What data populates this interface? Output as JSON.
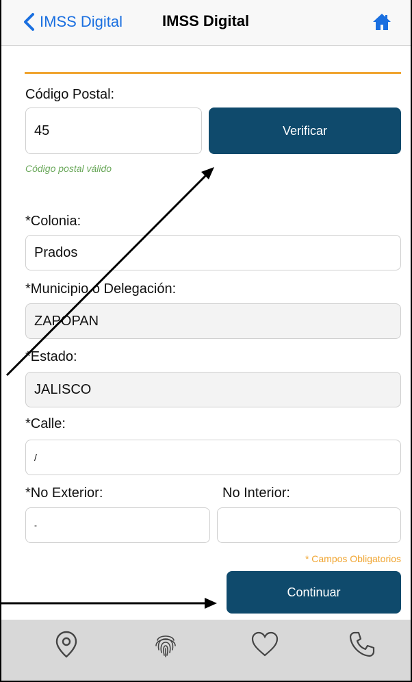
{
  "nav": {
    "back_label": "IMSS Digital",
    "title": "IMSS Digital"
  },
  "form": {
    "postal_label": "Código Postal:",
    "postal_value": "45",
    "verify_button": "Verificar",
    "postal_valid_msg": "Código postal válido",
    "colonia_label": "*Colonia:",
    "colonia_value": "Prados",
    "municipio_label": "*Municipio o Delegación:",
    "municipio_value": "ZAPOPAN",
    "estado_label": "*Estado:",
    "estado_value": "JALISCO",
    "calle_label": "*Calle:",
    "calle_value": "/",
    "no_exterior_label": "*No Exterior:",
    "no_exterior_value": "-",
    "no_interior_label": "No Interior:",
    "no_interior_value": "",
    "required_note": "* Campos Obligatorios",
    "continue_button": "Continuar"
  },
  "tabbar": {
    "icons": [
      "location-pin-icon",
      "fingerprint-icon",
      "heart-icon",
      "phone-icon"
    ]
  },
  "colors": {
    "accent_blue": "#1a6fe0",
    "button_navy": "#0f4a6c",
    "orange": "#f0a531",
    "valid_green": "#6aa85a",
    "tabbar_gray": "#d8d8d8"
  }
}
